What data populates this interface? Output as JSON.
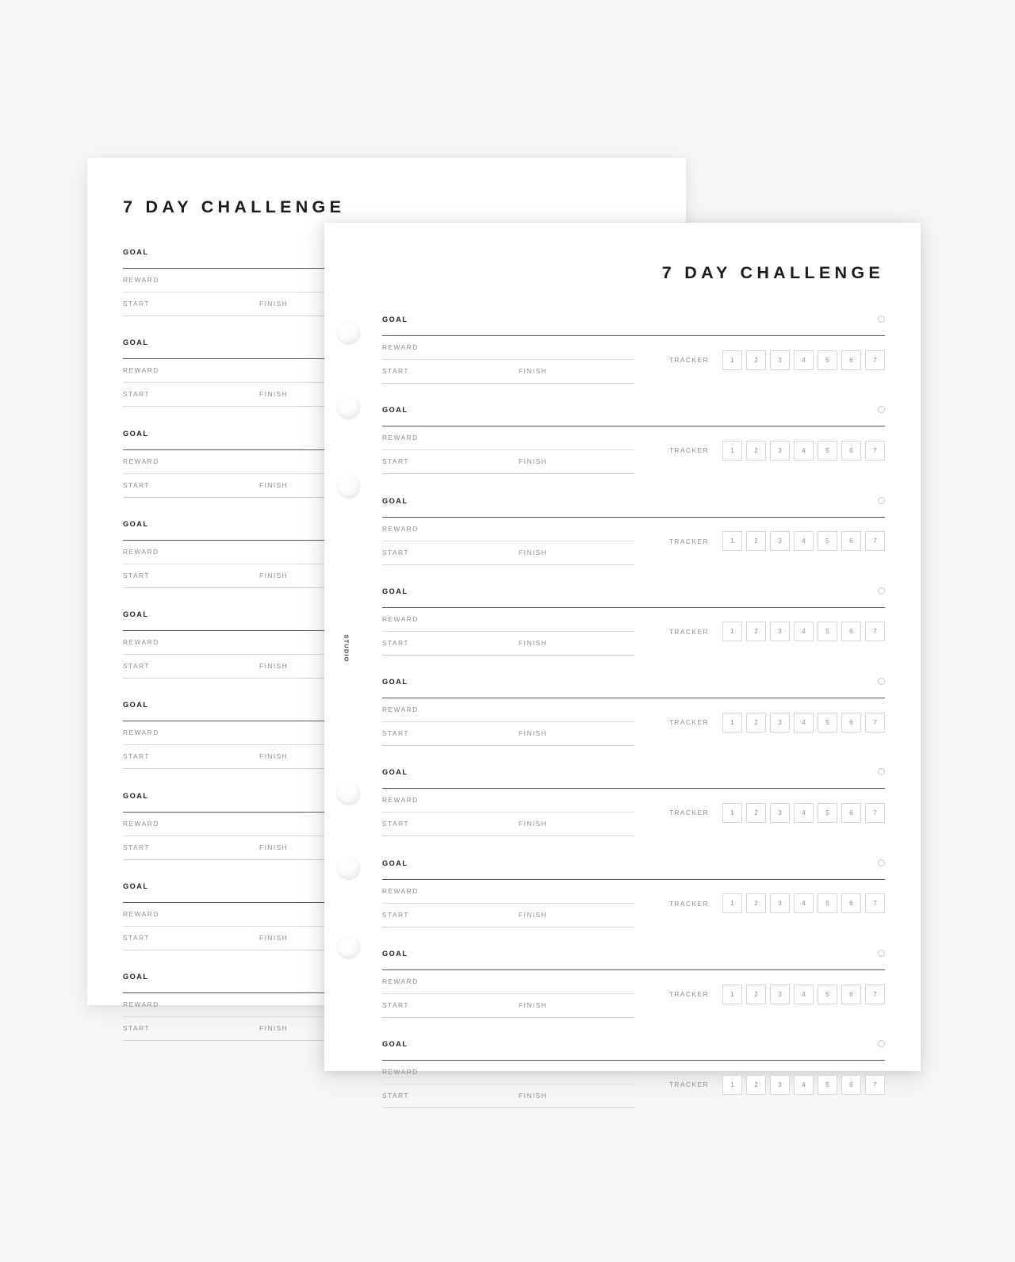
{
  "background_color": "#f7f7f7",
  "sheet_color": "#ffffff",
  "brand": {
    "vertical_text": "STUDIO"
  },
  "back_page": {
    "title": "7 DAY CHALLENGE",
    "labels": {
      "goal": "GOAL",
      "reward": "REWARD",
      "start": "START",
      "finish": "FINISH"
    },
    "goal_block_count": 9
  },
  "front_page": {
    "title": "7 DAY CHALLENGE",
    "labels": {
      "goal": "GOAL",
      "reward": "REWARD",
      "start": "START",
      "finish": "FINISH",
      "tracker": "TRACKER"
    },
    "tracker_days": [
      "1",
      "2",
      "3",
      "4",
      "5",
      "6",
      "7"
    ],
    "goal_block_count": 9
  },
  "colors": {
    "title_text": "#1d1d1d",
    "goal_label_text": "#1f1f1f",
    "field_label_text": "#8e8e90",
    "strong_rule": "#58585a",
    "light_rule": "#dcdcdd",
    "tracker_box_border": "#d8d8da",
    "check_circle_border": "#c9c9cb"
  }
}
